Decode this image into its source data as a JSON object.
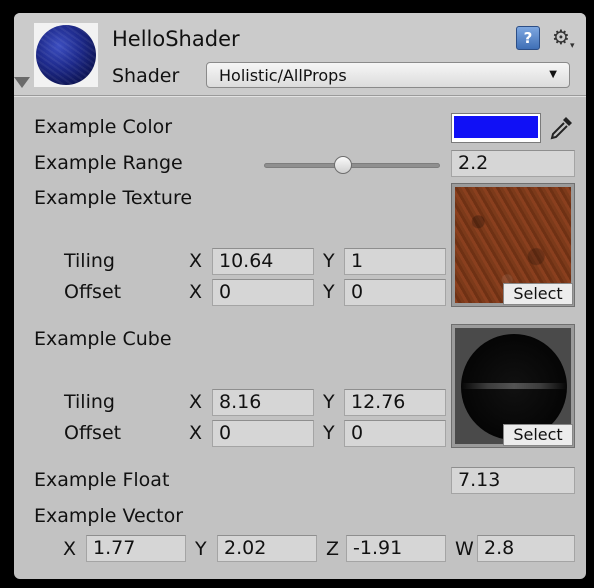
{
  "header": {
    "title": "HelloShader",
    "shader_label": "Shader",
    "shader_value": "Holistic/AllProps",
    "help_icon": "help-book-icon",
    "settings_icon": "gear-icon"
  },
  "properties": {
    "color": {
      "label": "Example Color",
      "value": "#1010f6"
    },
    "range": {
      "label": "Example Range",
      "value": "2.2",
      "slider_fraction": 0.45
    },
    "texture": {
      "label": "Example Texture",
      "tiling_label": "Tiling",
      "offset_label": "Offset",
      "tiling_x": "10.64",
      "tiling_y": "1",
      "offset_x": "0",
      "offset_y": "0",
      "select_label": "Select"
    },
    "cube": {
      "label": "Example Cube",
      "tiling_label": "Tiling",
      "offset_label": "Offset",
      "tiling_x": "8.16",
      "tiling_y": "12.76",
      "offset_x": "0",
      "offset_y": "0",
      "select_label": "Select"
    },
    "float": {
      "label": "Example Float",
      "value": "7.13"
    },
    "vector": {
      "label": "Example Vector",
      "x": "1.77",
      "y": "2.02",
      "z": "-1.91",
      "w": "2.8"
    }
  },
  "axis_labels": {
    "x": "X",
    "y": "Y",
    "z": "Z",
    "w": "W"
  }
}
